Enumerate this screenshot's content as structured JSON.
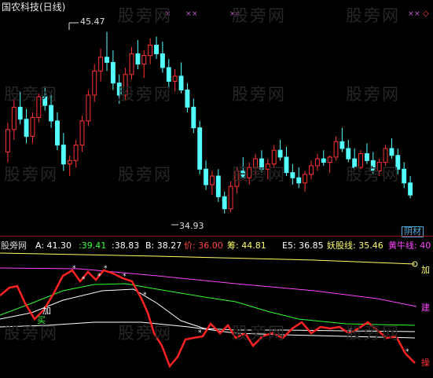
{
  "title": "国农科技(日线)",
  "watermark": "股旁网",
  "price_panel": {
    "high_label": "45.47",
    "low_label": "34.93",
    "corner_badge": "阴材",
    "marker_color": "#d05cd0",
    "up_color": "#ff3333",
    "down_color": "#54ffff"
  },
  "indicator_header": {
    "source": "股旁网",
    "A": "A: 41.30",
    "val2": ":39.41",
    "val3": ":38.83",
    "B": "B: 38.27",
    "price": "价: 36.00",
    "chou": "筹: 44.81",
    "e5": "E5: 36.85",
    "yao": "妖股线: 35.46",
    "niu": "黄牛线: 40"
  },
  "indicator_labels": {
    "jia_right": "加",
    "jian": "建",
    "jia_left": "加",
    "mai": "买",
    "cao": "操"
  },
  "chart_data": {
    "type": "candlestick",
    "candles": [
      [
        38.5,
        40.2,
        37.9,
        39.8
      ],
      [
        39.8,
        41.6,
        39.2,
        41.1
      ],
      [
        41.1,
        42.0,
        40.1,
        40.4
      ],
      [
        40.4,
        41.0,
        39.0,
        39.4
      ],
      [
        39.4,
        40.8,
        39.0,
        40.5
      ],
      [
        40.5,
        41.9,
        40.2,
        41.7
      ],
      [
        41.7,
        42.3,
        40.9,
        41.2
      ],
      [
        41.2,
        41.8,
        39.9,
        40.3
      ],
      [
        40.3,
        40.8,
        38.6,
        38.9
      ],
      [
        38.9,
        39.6,
        37.4,
        37.8
      ],
      [
        37.8,
        38.3,
        37.1,
        38.0
      ],
      [
        38.0,
        39.2,
        37.6,
        38.9
      ],
      [
        38.9,
        40.6,
        38.5,
        40.3
      ],
      [
        40.3,
        42.1,
        40.0,
        41.8
      ],
      [
        41.8,
        43.6,
        41.4,
        43.2
      ],
      [
        43.2,
        44.5,
        42.6,
        44.0
      ],
      [
        44.0,
        45.47,
        43.2,
        43.7
      ],
      [
        43.7,
        44.4,
        42.1,
        42.5
      ],
      [
        42.5,
        43.0,
        41.3,
        41.8
      ],
      [
        41.8,
        43.4,
        41.5,
        43.0
      ],
      [
        43.0,
        44.6,
        42.7,
        44.2
      ],
      [
        44.2,
        45.0,
        43.3,
        43.6
      ],
      [
        43.6,
        44.4,
        42.8,
        44.1
      ],
      [
        44.1,
        45.1,
        43.6,
        44.7
      ],
      [
        44.7,
        45.2,
        43.9,
        44.2
      ],
      [
        44.2,
        44.9,
        43.1,
        43.4
      ],
      [
        43.4,
        43.9,
        42.2,
        42.6
      ],
      [
        42.6,
        43.3,
        42.0,
        42.9
      ],
      [
        42.9,
        43.7,
        41.9,
        42.1
      ],
      [
        42.1,
        42.5,
        40.8,
        41.1
      ],
      [
        41.1,
        41.6,
        39.6,
        39.9
      ],
      [
        39.9,
        40.3,
        37.2,
        37.5
      ],
      [
        37.5,
        38.0,
        36.3,
        36.6
      ],
      [
        36.6,
        37.4,
        36.0,
        37.1
      ],
      [
        37.1,
        37.5,
        35.6,
        35.9
      ],
      [
        35.9,
        36.2,
        34.93,
        35.2
      ],
      [
        35.2,
        36.8,
        35.0,
        36.5
      ],
      [
        36.5,
        37.6,
        36.1,
        37.4
      ],
      [
        37.4,
        38.2,
        36.9,
        37.0
      ],
      [
        37.0,
        37.9,
        36.6,
        37.6
      ],
      [
        37.6,
        38.4,
        37.2,
        38.1
      ],
      [
        38.1,
        38.6,
        37.3,
        37.5
      ],
      [
        37.5,
        38.1,
        36.9,
        37.8
      ],
      [
        37.8,
        38.9,
        37.6,
        38.6
      ],
      [
        38.6,
        39.2,
        38.0,
        38.2
      ],
      [
        38.2,
        38.8,
        37.1,
        37.3
      ],
      [
        37.3,
        37.8,
        36.6,
        37.0
      ],
      [
        37.0,
        37.6,
        36.4,
        36.7
      ],
      [
        36.7,
        37.4,
        36.2,
        37.2
      ],
      [
        37.2,
        38.0,
        36.9,
        37.7
      ],
      [
        37.7,
        38.4,
        37.4,
        38.1
      ],
      [
        38.1,
        38.6,
        37.7,
        37.9
      ],
      [
        37.9,
        38.3,
        37.3,
        38.2
      ],
      [
        38.2,
        39.4,
        38.0,
        39.1
      ],
      [
        39.1,
        39.9,
        38.5,
        38.7
      ],
      [
        38.7,
        39.2,
        37.9,
        38.1
      ],
      [
        38.1,
        38.7,
        37.4,
        37.6
      ],
      [
        37.6,
        38.6,
        37.5,
        38.4
      ],
      [
        38.4,
        39.0,
        37.8,
        38.0
      ],
      [
        38.0,
        38.5,
        37.2,
        37.4
      ],
      [
        37.4,
        38.1,
        37.1,
        37.9
      ],
      [
        37.9,
        38.9,
        37.7,
        38.7
      ],
      [
        38.7,
        39.3,
        38.1,
        38.3
      ],
      [
        38.3,
        38.7,
        37.2,
        37.5
      ],
      [
        37.5,
        37.9,
        36.4,
        36.7
      ],
      [
        36.7,
        37.1,
        35.8,
        36.0
      ]
    ],
    "ylim": [
      34.0,
      46.5
    ]
  }
}
